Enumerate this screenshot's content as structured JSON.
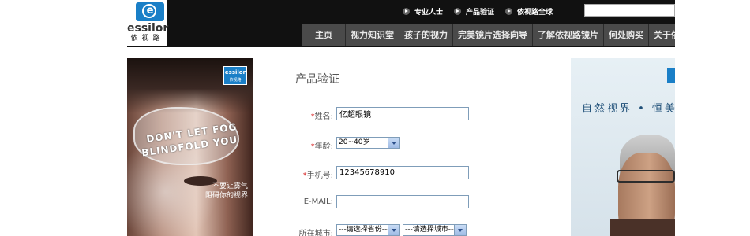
{
  "header": {
    "logo": {
      "wordmark": "essilor",
      "subtitle": "依视路"
    },
    "top_links": [
      {
        "label": "专业人士",
        "icon": "arrow-circle-icon"
      },
      {
        "label": "产品验证",
        "icon": "arrow-circle-icon"
      },
      {
        "label": "依视路全球",
        "icon": "arrow-circle-icon"
      }
    ],
    "search": {
      "value": ""
    },
    "nav": [
      "主页",
      "视力知识堂",
      "孩子的视力",
      "完美镜片选择向导",
      "了解依视路镜片",
      "何处购买",
      "关于依"
    ]
  },
  "left_promo": {
    "slogan_line1": "DON'T LET FOG",
    "slogan_line2": "BLINDFOLD YOU",
    "caption_line1": "不要让雾气",
    "caption_line2": "阻碍你的视界",
    "badge_word": "essilor",
    "badge_sub": "依视路"
  },
  "right_promo": {
    "slogan": "自然视界 • 恒美"
  },
  "form": {
    "title": "产品验证",
    "name": {
      "label": "姓名:",
      "required": true,
      "value": "亿超眼镜"
    },
    "age": {
      "label": "年龄:",
      "required": true,
      "selected": "20~40岁"
    },
    "phone": {
      "label": "手机号:",
      "required": true,
      "value": "12345678910"
    },
    "email": {
      "label": "E-MAIL:",
      "required": false,
      "value": ""
    },
    "city": {
      "label": "所在城市:",
      "province_selected": "---请选择省份---",
      "city_selected": "---请选择城市---"
    }
  },
  "colors": {
    "header_bg": "#111111",
    "nav_bg": "#4a4a4a",
    "brand_blue": "#1a7fc7",
    "required_star": "#d62020"
  }
}
